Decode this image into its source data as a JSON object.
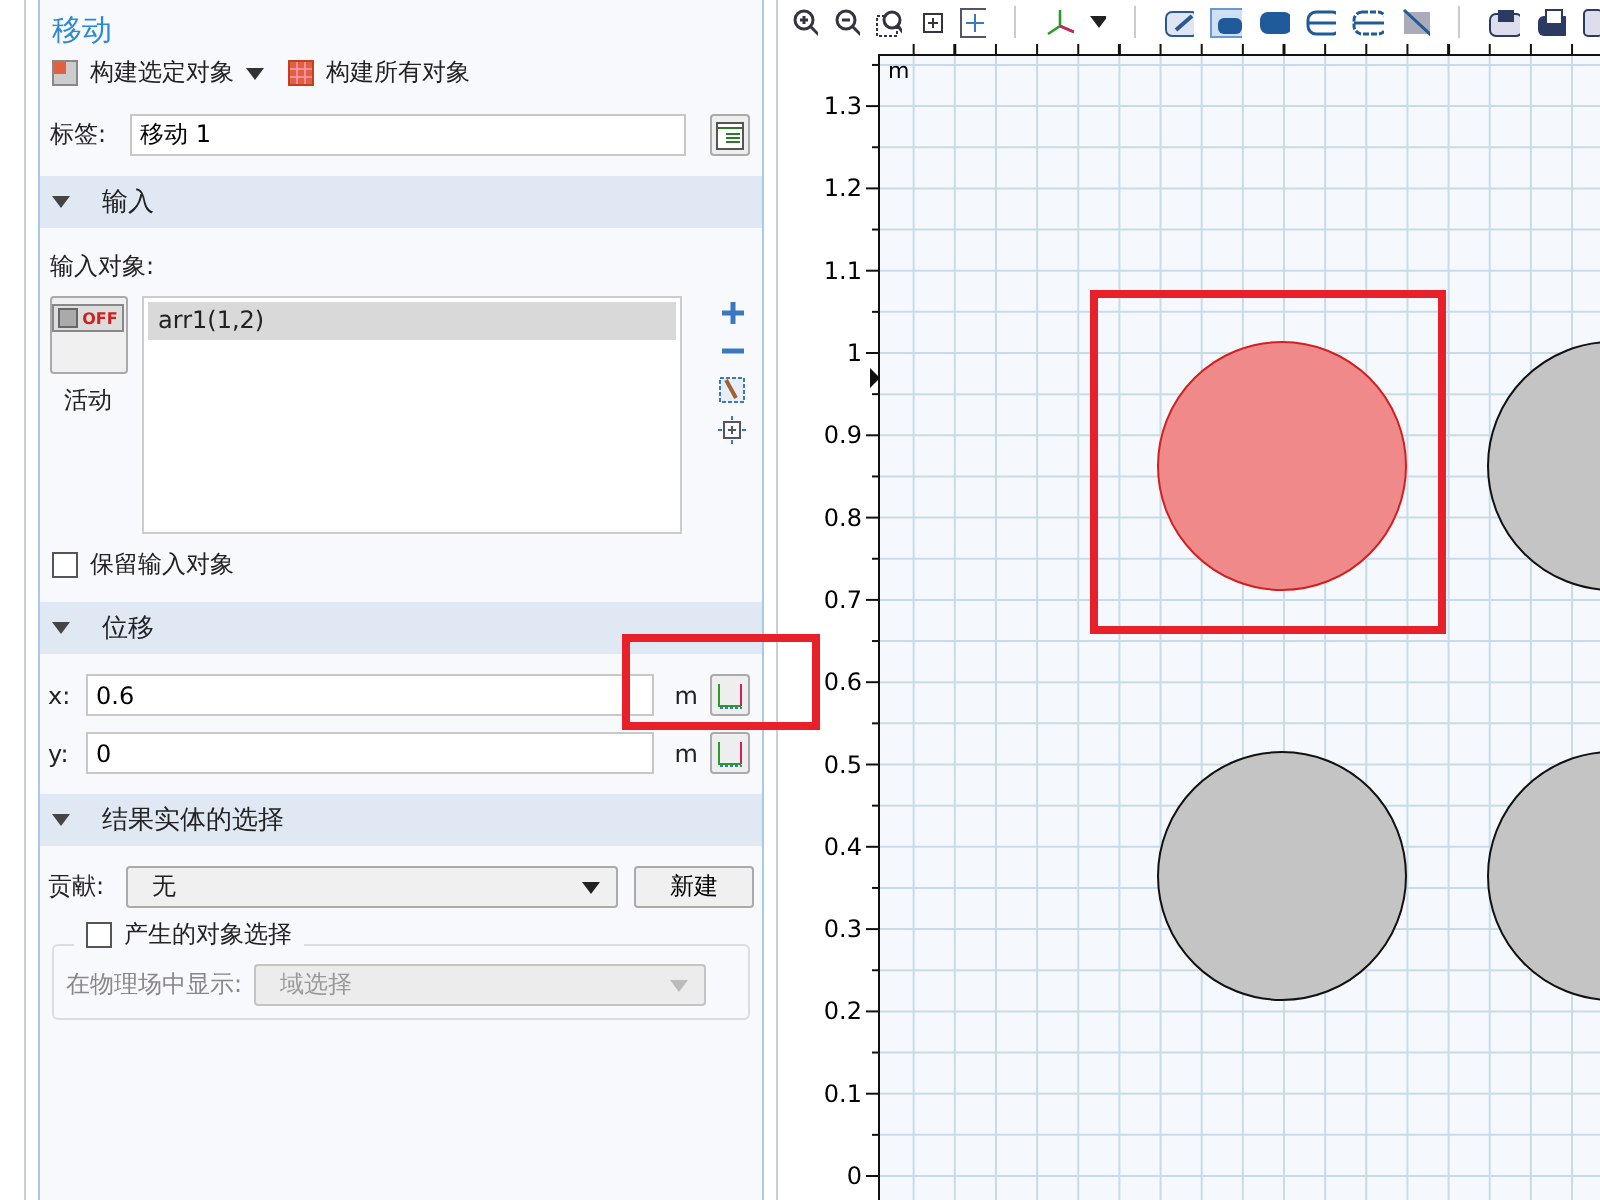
{
  "settings": {
    "title": "移动",
    "build_selected": "构建选定对象",
    "build_all": "构建所有对象",
    "label_field": {
      "label": "标签:",
      "value": "移动 1"
    },
    "input_section": {
      "title": "输入",
      "expanded": true,
      "objects_label": "输入对象:",
      "toggle_text": "OFF",
      "toggle_label": "活动",
      "objects": [
        {
          "name": "arr1(1,2)",
          "selected": true
        }
      ],
      "keep_input": {
        "label": "保留输入对象",
        "checked": false
      }
    },
    "displacement_section": {
      "title": "位移",
      "expanded": true,
      "fields": [
        {
          "label": "x:",
          "value": "0.6",
          "unit": "m"
        },
        {
          "label": "y:",
          "value": "0",
          "unit": "m"
        }
      ]
    },
    "selection_section": {
      "title": "结果实体的选择",
      "expanded": true,
      "contribute": {
        "label": "贡献:",
        "value": "无"
      },
      "new_button": "新建",
      "resulting_selection": {
        "label": "产生的对象选择",
        "checked": false
      },
      "show_in_physics": {
        "label": "在物理场中显示:",
        "value": "域选择",
        "disabled": true
      }
    }
  },
  "graphics": {
    "unit": "m",
    "y_ticks": [
      "1.3",
      "1.2",
      "1.1",
      "1",
      "0.9",
      "0.8",
      "0.7",
      "0.6",
      "0.5",
      "0.4",
      "0.3",
      "0.2",
      "0.1",
      "0"
    ]
  }
}
